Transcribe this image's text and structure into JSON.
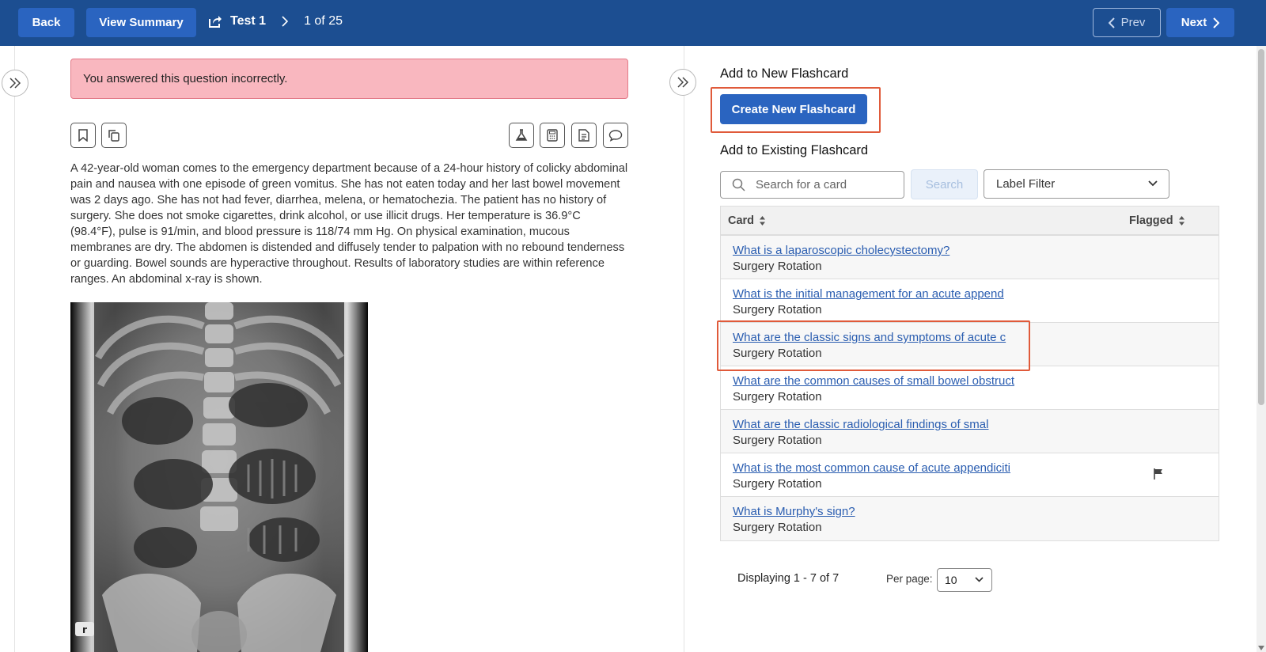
{
  "topbar": {
    "back_label": "Back",
    "summary_label": "View Summary",
    "test_name": "Test 1",
    "position": "1 of 25",
    "prev_label": "Prev",
    "next_label": "Next",
    "color": "#1c4e91"
  },
  "question": {
    "alert": "You answered this question incorrectly.",
    "stem": "A 42-year-old woman comes to the emergency department because of a 24-hour history of colicky abdominal pain and nausea with one episode of green vomitus. She has not eaten today and her last bowel movement was 2 days ago. She has not had fever, diarrhea, melena, or hematochezia. The patient has no history of surgery. She does not smoke cigarettes, drink alcohol, or use illicit drugs. Her temperature is 36.9°C (98.4°F), pulse is 91/min, and blood pressure is 118/74 mm Hg. On physical examination, mucous membranes are dry. The abdomen is distended and diffusely tender to palpation with no rebound tenderness or guarding. Bowel sounds are hyperactive throughout. Results of laboratory studies are within reference ranges. An abdominal x-ray is shown.",
    "tool_icons": [
      "bookmark-icon",
      "copy-icon",
      "lab-flask-icon",
      "calculator-icon",
      "notes-icon",
      "comment-icon"
    ]
  },
  "flashcards": {
    "new_heading": "Add to New Flashcard",
    "create_label": "Create New Flashcard",
    "existing_heading": "Add to Existing Flashcard",
    "search_placeholder": "Search for a card",
    "search_button": "Search",
    "label_filter": "Label Filter",
    "columns": {
      "card": "Card",
      "flagged": "Flagged"
    },
    "rows": [
      {
        "title": "What is a laparoscopic cholecystectomy?",
        "deck": "Surgery Rotation",
        "flagged": false
      },
      {
        "title": "What is the initial management for an acute append",
        "deck": "Surgery Rotation",
        "flagged": false
      },
      {
        "title": "What are the classic signs and symptoms of acute c",
        "deck": "Surgery Rotation",
        "flagged": false
      },
      {
        "title": "What are the common causes of small bowel obstruct",
        "deck": "Surgery Rotation",
        "flagged": false
      },
      {
        "title": "What are the classic radiological findings of smal",
        "deck": "Surgery Rotation",
        "flagged": false
      },
      {
        "title": "What is the most common cause of acute appendiciti",
        "deck": "Surgery Rotation",
        "flagged": true
      },
      {
        "title": "What is Murphy's sign?",
        "deck": "Surgery Rotation",
        "flagged": false
      }
    ],
    "displaying": "Displaying 1 - 7 of 7",
    "per_page_label": "Per page:",
    "per_page_value": "10"
  }
}
